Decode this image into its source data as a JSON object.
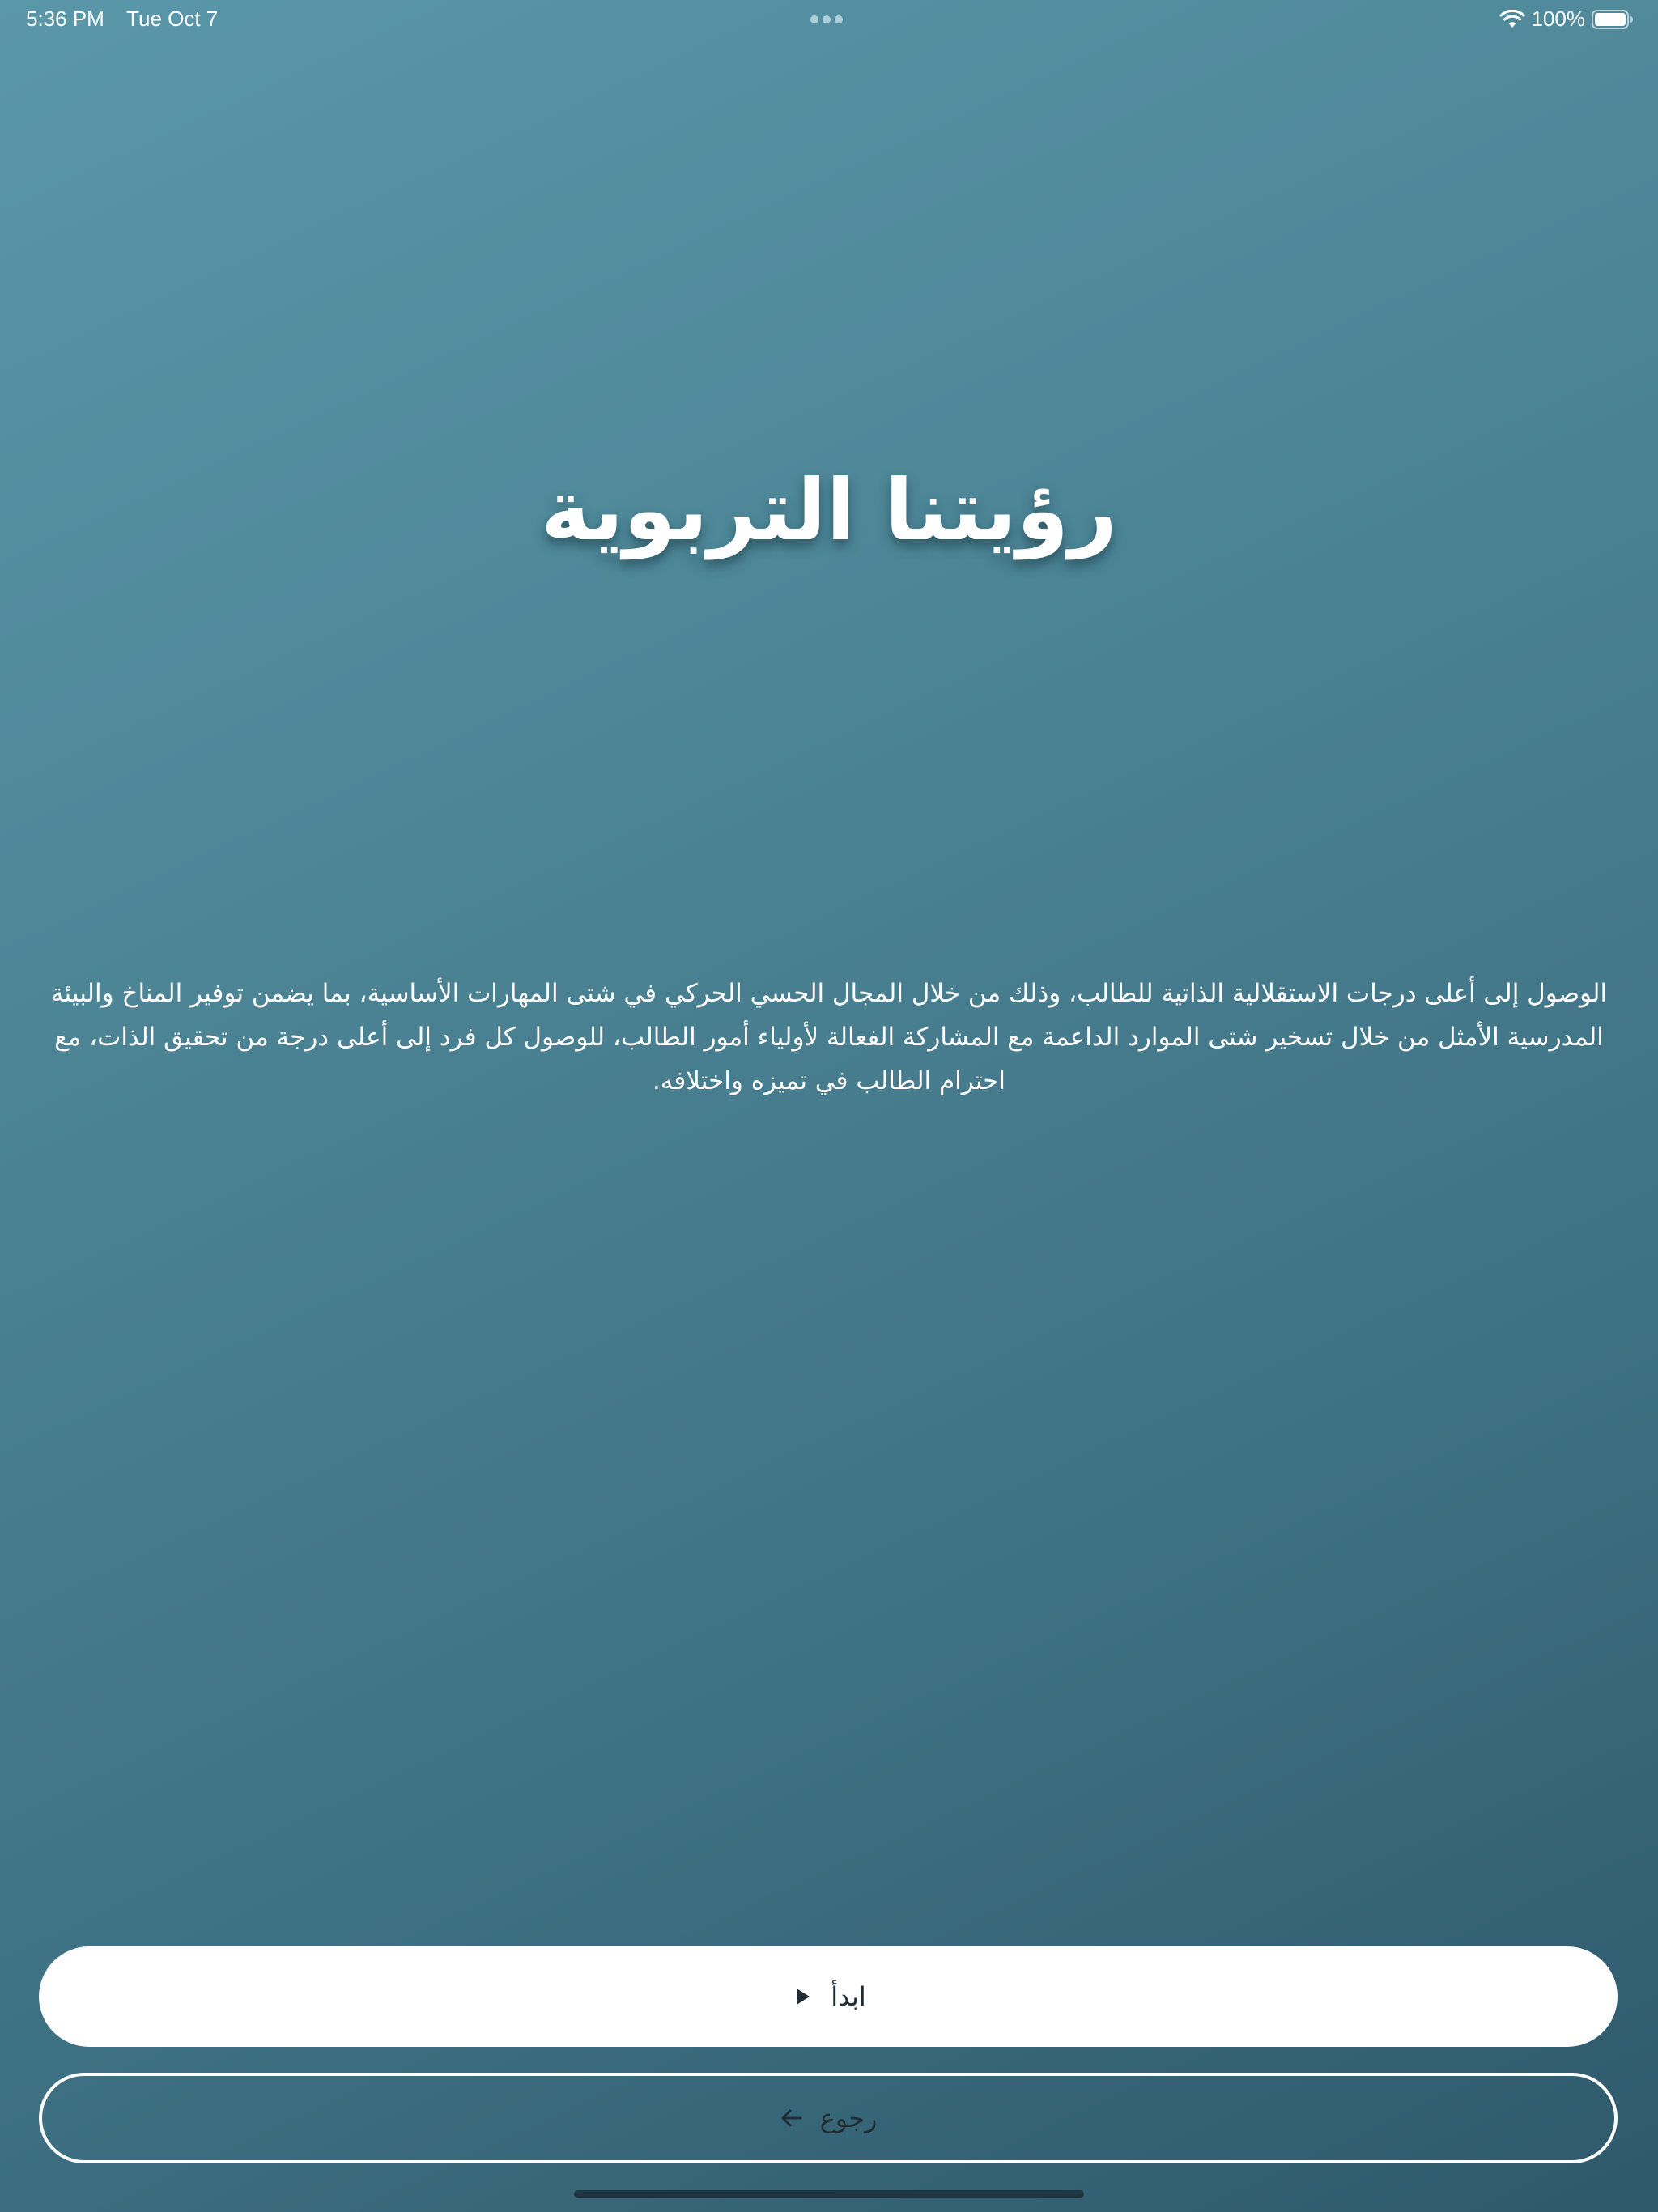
{
  "status_bar": {
    "time": "5:36 PM",
    "date": "Tue Oct 7",
    "battery": "100%",
    "icons": [
      "wifi-icon",
      "battery-icon"
    ]
  },
  "main": {
    "title": "رؤيتنا التربوية",
    "description": "الوصول إلى أعلى درجات الاستقلالية الذاتية للطالب، وذلك من خلال المجال الحسي الحركي في شتى المهارات الأساسية، بما يضمن توفير المناخ والبيئة المدرسية الأمثل من خلال تسخير شتى الموارد الداعمة مع المشاركة الفعالة لأولياء أمور الطالب، للوصول كل فرد إلى أعلى درجة من تحقيق الذات، مع احترام الطالب في تميزه واختلافه."
  },
  "buttons": {
    "start_label": "ابدأ",
    "start_icon": "play-icon",
    "back_label": "رجوع",
    "back_icon": "arrow-left-icon"
  },
  "colors": {
    "gradient_top": "#5a97a9",
    "gradient_bottom": "#2e596b",
    "button_text": "#1f2d33"
  }
}
